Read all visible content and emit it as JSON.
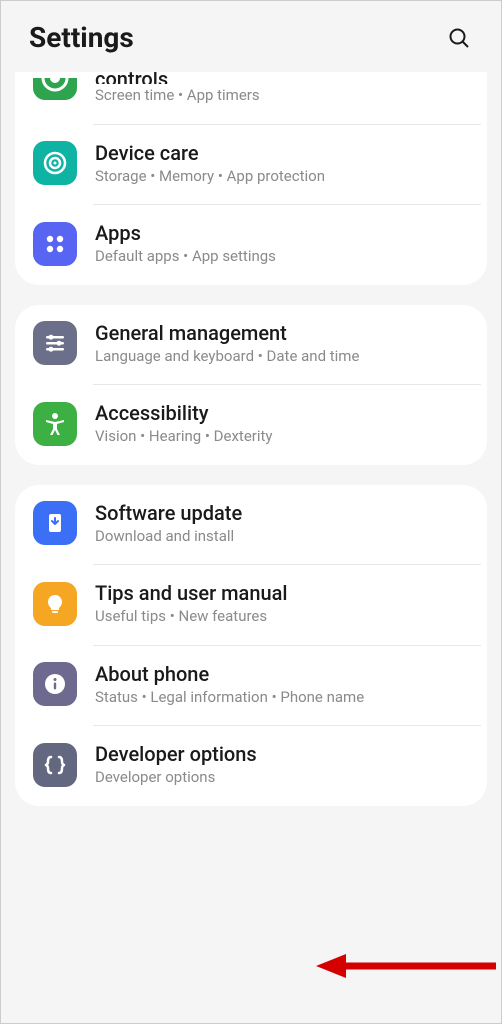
{
  "header": {
    "title": "Settings"
  },
  "groups": [
    {
      "rows": [
        {
          "id": "digital-wellbeing",
          "title": "controls",
          "sub": "Screen time  •  App timers",
          "partial": true
        },
        {
          "id": "device-care",
          "title": "Device care",
          "sub": "Storage  •  Memory  •  App protection"
        },
        {
          "id": "apps",
          "title": "Apps",
          "sub": "Default apps  •  App settings"
        }
      ]
    },
    {
      "rows": [
        {
          "id": "general-management",
          "title": "General management",
          "sub": "Language and keyboard  •  Date and time"
        },
        {
          "id": "accessibility",
          "title": "Accessibility",
          "sub": "Vision  •  Hearing  •  Dexterity"
        }
      ]
    },
    {
      "rows": [
        {
          "id": "software-update",
          "title": "Software update",
          "sub": "Download and install"
        },
        {
          "id": "tips",
          "title": "Tips and user manual",
          "sub": "Useful tips  •  New features"
        },
        {
          "id": "about-phone",
          "title": "About phone",
          "sub": "Status  •  Legal information  •  Phone name"
        },
        {
          "id": "developer-options",
          "title": "Developer options",
          "sub": "Developer options"
        }
      ]
    }
  ]
}
